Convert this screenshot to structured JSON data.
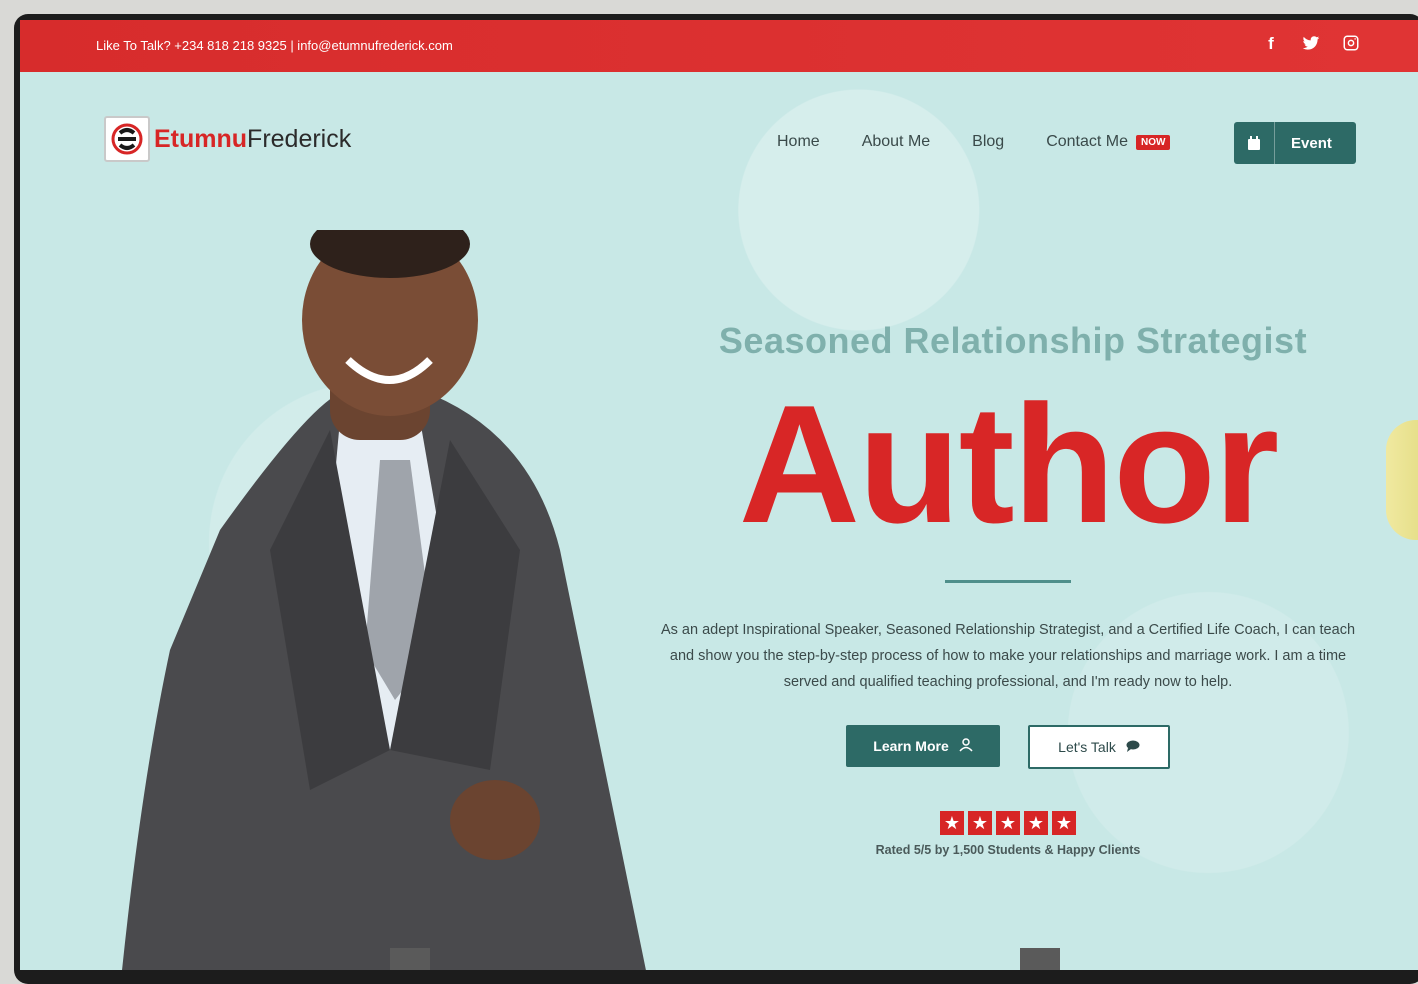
{
  "topbar": {
    "contact_text": "Like To Talk? +234 818 218 9325  |  info@etumnufrederick.com",
    "socials": [
      "facebook-icon",
      "twitter-icon",
      "instagram-icon"
    ]
  },
  "logo": {
    "part1": "Etumnu",
    "part2": "Frederick"
  },
  "nav": {
    "home": "Home",
    "about": "About Me",
    "blog": "Blog",
    "contact": "Contact Me",
    "contact_badge": "NOW",
    "event": "Event"
  },
  "hero": {
    "subtitle": "Seasoned Relationship Strategist",
    "headline": "Author",
    "description": "As an adept Inspirational Speaker, Seasoned Relationship Strategist, and a Certified Life Coach, I can teach and show you the step-by-step process of how to make your relationships and marriage work. I am a time served and qualified teaching professional, and I'm ready now to help.",
    "learn_more": "Learn More",
    "lets_talk": "Let's Talk",
    "rating_stars": 5,
    "rating_text": "Rated 5/5 by 1,500 Students & Happy Clients"
  },
  "colors": {
    "brand_red": "#d72626",
    "brand_teal": "#2d6a66",
    "background": "#c8e8e6"
  }
}
